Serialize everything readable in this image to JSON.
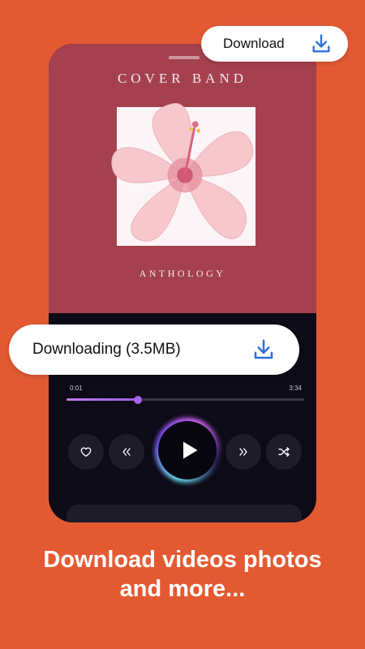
{
  "top_pill": {
    "label": "Download",
    "icon": "download-icon"
  },
  "player": {
    "album": {
      "band": "COVER BAND",
      "subtitle": "ANTHOLOGY"
    },
    "progress": {
      "current": "0:01",
      "total": "3:34",
      "fraction": 0.3
    },
    "controls": [
      "heart-icon",
      "rewind-icon",
      "play-icon",
      "fast-forward-icon",
      "shuffle-icon"
    ]
  },
  "downloading_pill": {
    "label": "Downloading (3.5MB)",
    "icon": "download-icon"
  },
  "headline": {
    "line1": "Download videos photos",
    "line2": "and more..."
  },
  "colors": {
    "background": "#e35a32",
    "album_bg": "#a5414f",
    "player_bg": "#0d0b17",
    "accent": "#a765ea",
    "download_icon": "#2f6fd6"
  }
}
